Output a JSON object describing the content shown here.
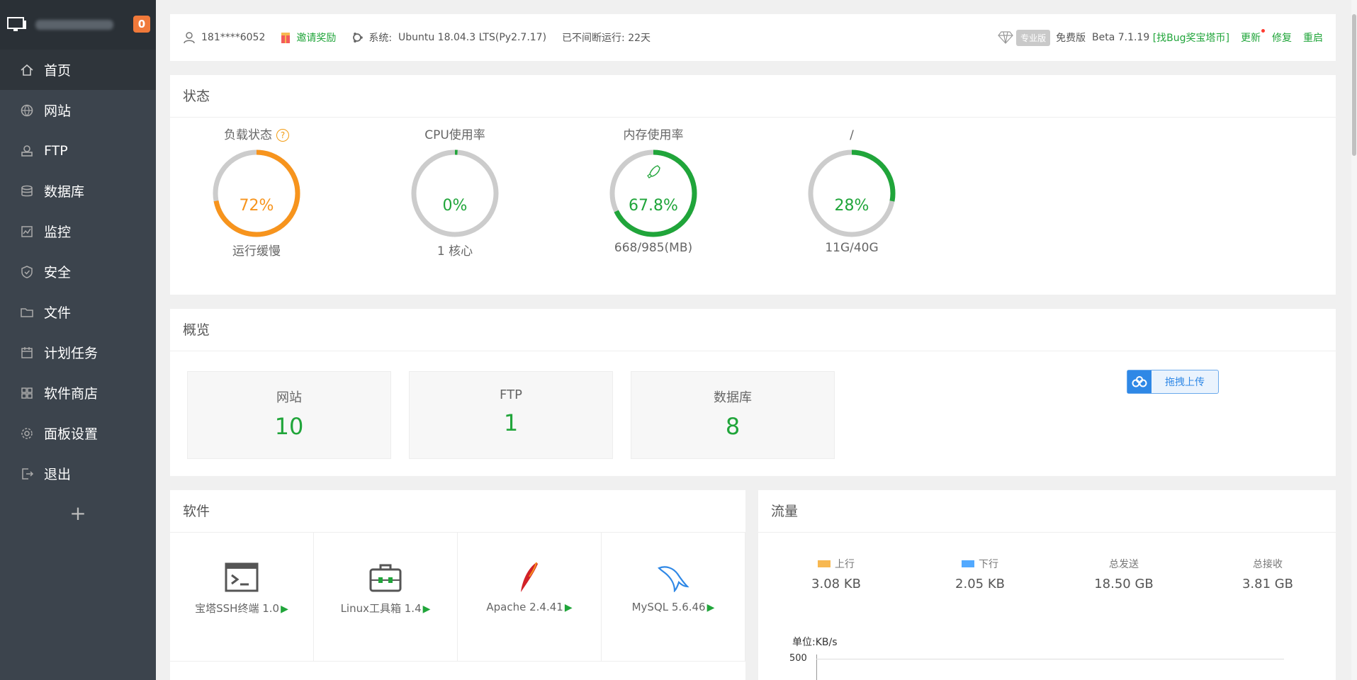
{
  "sidebar": {
    "badge": "0",
    "items": [
      {
        "label": "首页",
        "icon": "home-icon"
      },
      {
        "label": "网站",
        "icon": "globe-icon"
      },
      {
        "label": "FTP",
        "icon": "ftp-icon"
      },
      {
        "label": "数据库",
        "icon": "database-icon"
      },
      {
        "label": "监控",
        "icon": "monitor-icon"
      },
      {
        "label": "安全",
        "icon": "shield-icon"
      },
      {
        "label": "文件",
        "icon": "folder-icon"
      },
      {
        "label": "计划任务",
        "icon": "calendar-icon"
      },
      {
        "label": "软件商店",
        "icon": "grid-icon"
      },
      {
        "label": "面板设置",
        "icon": "gear-icon"
      },
      {
        "label": "退出",
        "icon": "logout-icon"
      }
    ],
    "add": "+"
  },
  "topbar": {
    "user": "181****6052",
    "invite": "邀请奖励",
    "system_label": "系统:",
    "system_value": "Ubuntu 18.04.3 LTS(Py2.7.17)",
    "uptime": "已不间断运行: 22天",
    "pro": "专业版",
    "free": "免费版",
    "version": "Beta 7.1.19",
    "bug_link": "[找Bug奖宝塔币]",
    "update": "更新",
    "repair": "修复",
    "restart": "重启"
  },
  "status": {
    "title": "状态",
    "gauges": [
      {
        "title": "负载状态",
        "value": "72%",
        "percent": 72,
        "foot": "运行缓慢",
        "color": "#f7941d",
        "help": "?"
      },
      {
        "title": "CPU使用率",
        "value": "0%",
        "percent": 1,
        "foot": "1 核心",
        "color": "#20a53a"
      },
      {
        "title": "内存使用率",
        "value": "67.8%",
        "percent": 67.8,
        "foot": "668/985(MB)",
        "color": "#20a53a"
      },
      {
        "title": "/",
        "value": "28%",
        "percent": 28,
        "foot": "11G/40G",
        "color": "#20a53a"
      }
    ]
  },
  "overview": {
    "title": "概览",
    "cards": [
      {
        "label": "网站",
        "value": "10"
      },
      {
        "label": "FTP",
        "value": "1"
      },
      {
        "label": "数据库",
        "value": "8"
      }
    ],
    "upload_btn": "拖拽上传"
  },
  "software": {
    "title": "软件",
    "items": [
      {
        "name": "宝塔SSH终端 1.0",
        "icon": "terminal-icon"
      },
      {
        "name": "Linux工具箱 1.4",
        "icon": "toolbox-icon"
      },
      {
        "name": "Apache 2.4.41",
        "icon": "apache-feather-icon"
      },
      {
        "name": "MySQL 5.6.46",
        "icon": "mysql-dolphin-icon"
      }
    ],
    "play": "▶"
  },
  "traffic": {
    "title": "流量",
    "up_label": "上行",
    "up_value": "3.08 KB",
    "down_label": "下行",
    "down_value": "2.05 KB",
    "sent_label": "总发送",
    "sent_value": "18.50 GB",
    "recv_label": "总接收",
    "recv_value": "3.81 GB",
    "unit": "单位:KB/s",
    "axis_max": "500",
    "up_color": "#f7b851",
    "down_color": "#52a9ff"
  },
  "colors": {
    "accent": "#20a53a",
    "warning": "#f7941d",
    "sidebar": "#3c444d"
  }
}
